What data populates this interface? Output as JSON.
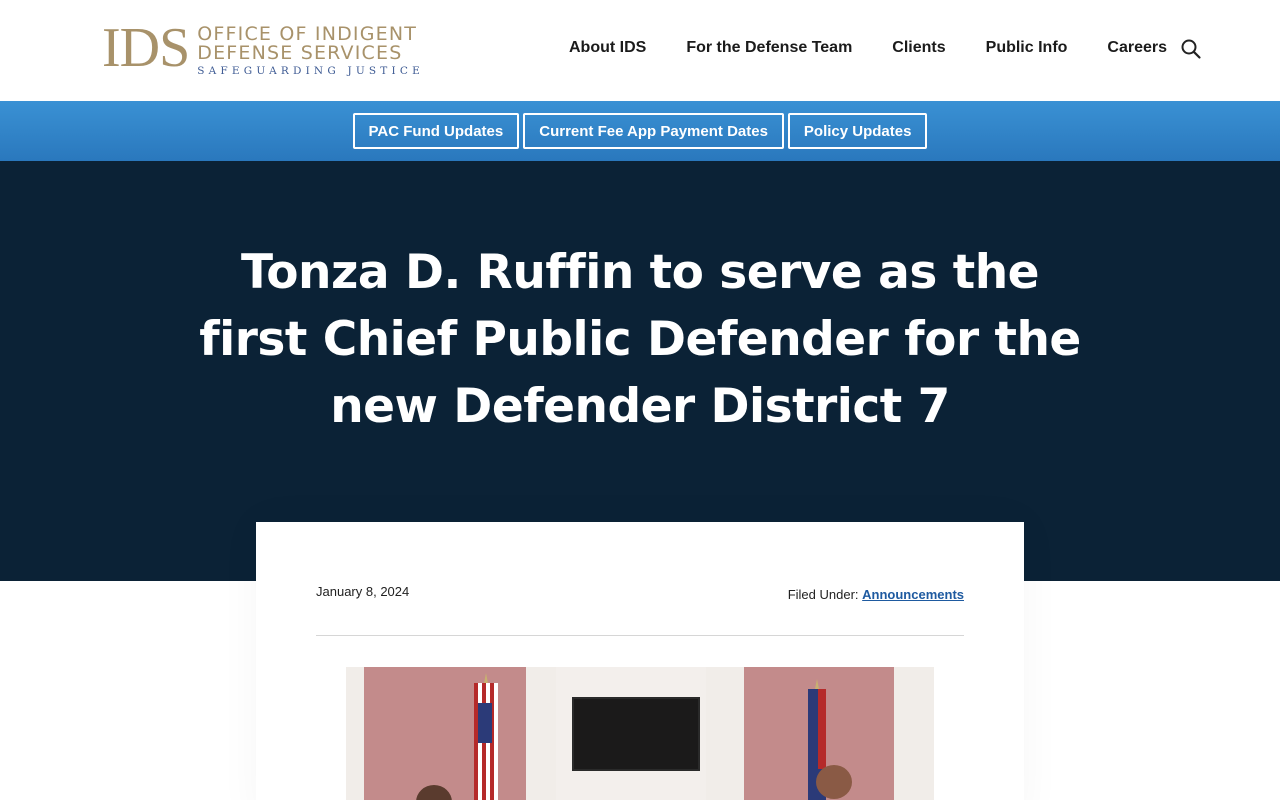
{
  "header": {
    "logo_mark": "IDS",
    "logo_line1": "OFFICE OF INDIGENT",
    "logo_line2": "DEFENSE SERVICES",
    "logo_tagline": "SAFEGUARDING JUSTICE",
    "nav": [
      {
        "label": "About IDS"
      },
      {
        "label": "For the Defense Team"
      },
      {
        "label": "Clients"
      },
      {
        "label": "Public Info"
      },
      {
        "label": "Careers"
      }
    ],
    "search_icon": "search-icon"
  },
  "quick_links": [
    {
      "label": "PAC Fund Updates"
    },
    {
      "label": "Current Fee App Payment Dates"
    },
    {
      "label": "Policy Updates"
    }
  ],
  "hero": {
    "title": "Tonza D. Ruffin to serve as the first Chief Public Defender for the new Defender District 7"
  },
  "article": {
    "date": "January 8, 2024",
    "filed_under_label": "Filed Under:",
    "category": "Announcements"
  },
  "colors": {
    "brand_gold": "#a8926a",
    "brand_blue": "#3d5a93",
    "hero_bg": "#0b2236",
    "bar_blue": "#2f84c8",
    "link_blue": "#1e5aa0"
  }
}
